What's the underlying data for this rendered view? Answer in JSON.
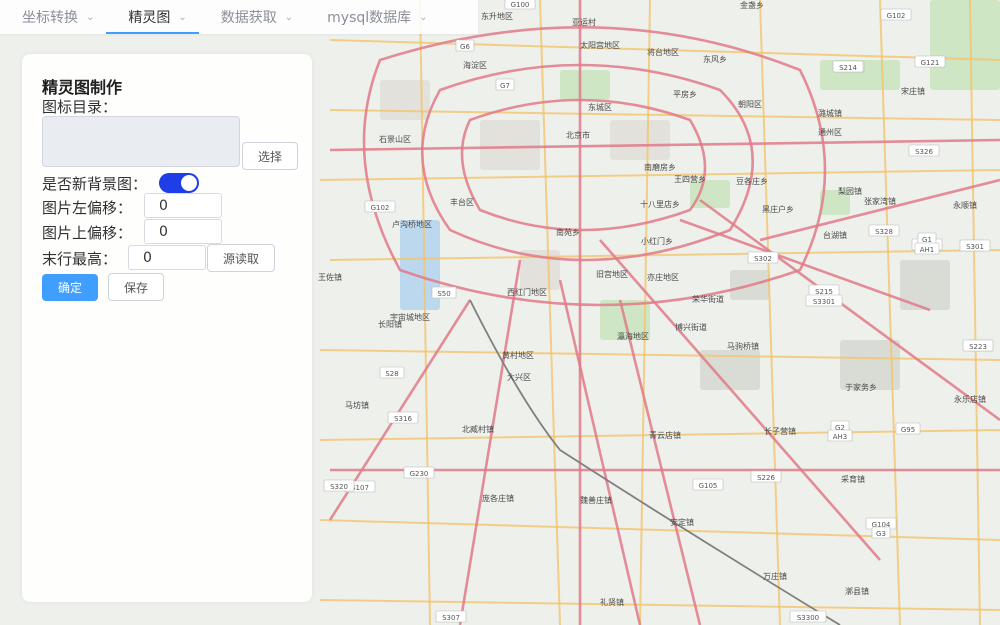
{
  "nav": {
    "tabs": [
      {
        "label": "坐标转换"
      },
      {
        "label": "精灵图"
      },
      {
        "label": "数据获取"
      },
      {
        "label": "mysql数据库"
      }
    ],
    "active_index": 1
  },
  "panel": {
    "title": "精灵图制作",
    "icon_dir_label": "图标目录：",
    "icon_dir_value": "",
    "select_button": "选择",
    "new_bg_label": "是否新背景图：",
    "new_bg_on": true,
    "left_offset_label": "图片左偏移：",
    "left_offset_value": "0",
    "top_offset_label": "图片上偏移：",
    "top_offset_value": "0",
    "last_row_label": "末行最高：",
    "last_row_value": "0",
    "read_button": "源读取",
    "confirm_button": "确定",
    "save_button": "保存"
  },
  "map": {
    "labels": [
      "东升地区",
      "亚运村",
      "金盏乡",
      "海淀区",
      "太阳宫地区",
      "将台地区",
      "东风乡",
      "平房乡",
      "石景山区",
      "东城区",
      "北京市",
      "朝阳区",
      "通州区",
      "丰台区",
      "南磨房乡",
      "王四营乡",
      "豆各庄乡",
      "十八里店乡",
      "黑庄户乡",
      "梨园镇",
      "张家湾镇",
      "卢沟桥地区",
      "南苑乡",
      "小红门乡",
      "台湖镇",
      "旧宫地区",
      "亦庄地区",
      "荣华街道",
      "博兴街道",
      "马驹桥镇",
      "西红门地区",
      "瀛海地区",
      "黄村地区",
      "大兴区",
      "北臧村镇",
      "青云店镇",
      "长子营镇",
      "于家务乡",
      "永乐店镇",
      "采育镇",
      "庞各庄镇",
      "魏善庄镇",
      "安定镇",
      "礼贤镇",
      "万庄镇",
      "漷县镇",
      "宋庄镇",
      "潞城镇",
      "永顺镇",
      "长阳镇",
      "王佐镇",
      "宇宙城地区",
      "马坊镇"
    ],
    "road_shields": [
      "G6",
      "G7",
      "G102",
      "G121",
      "G205",
      "G230",
      "G100",
      "G102",
      "S28",
      "S50",
      "S214",
      "S215",
      "S3301",
      "S302",
      "S316",
      "S107",
      "S326",
      "S328",
      "S329",
      "S2",
      "S33",
      "G105",
      "S226",
      "G104",
      "G3",
      "G1",
      "AH1",
      "G2",
      "AH3",
      "G95",
      "S307",
      "S3300",
      "S320",
      "S301",
      "S223"
    ]
  },
  "colors": {
    "accent": "#409eff",
    "toggle": "#1e3ee8",
    "road_major": "#e07a88",
    "road_secondary": "#f2c46d",
    "map_bg": "#eef0ec"
  }
}
